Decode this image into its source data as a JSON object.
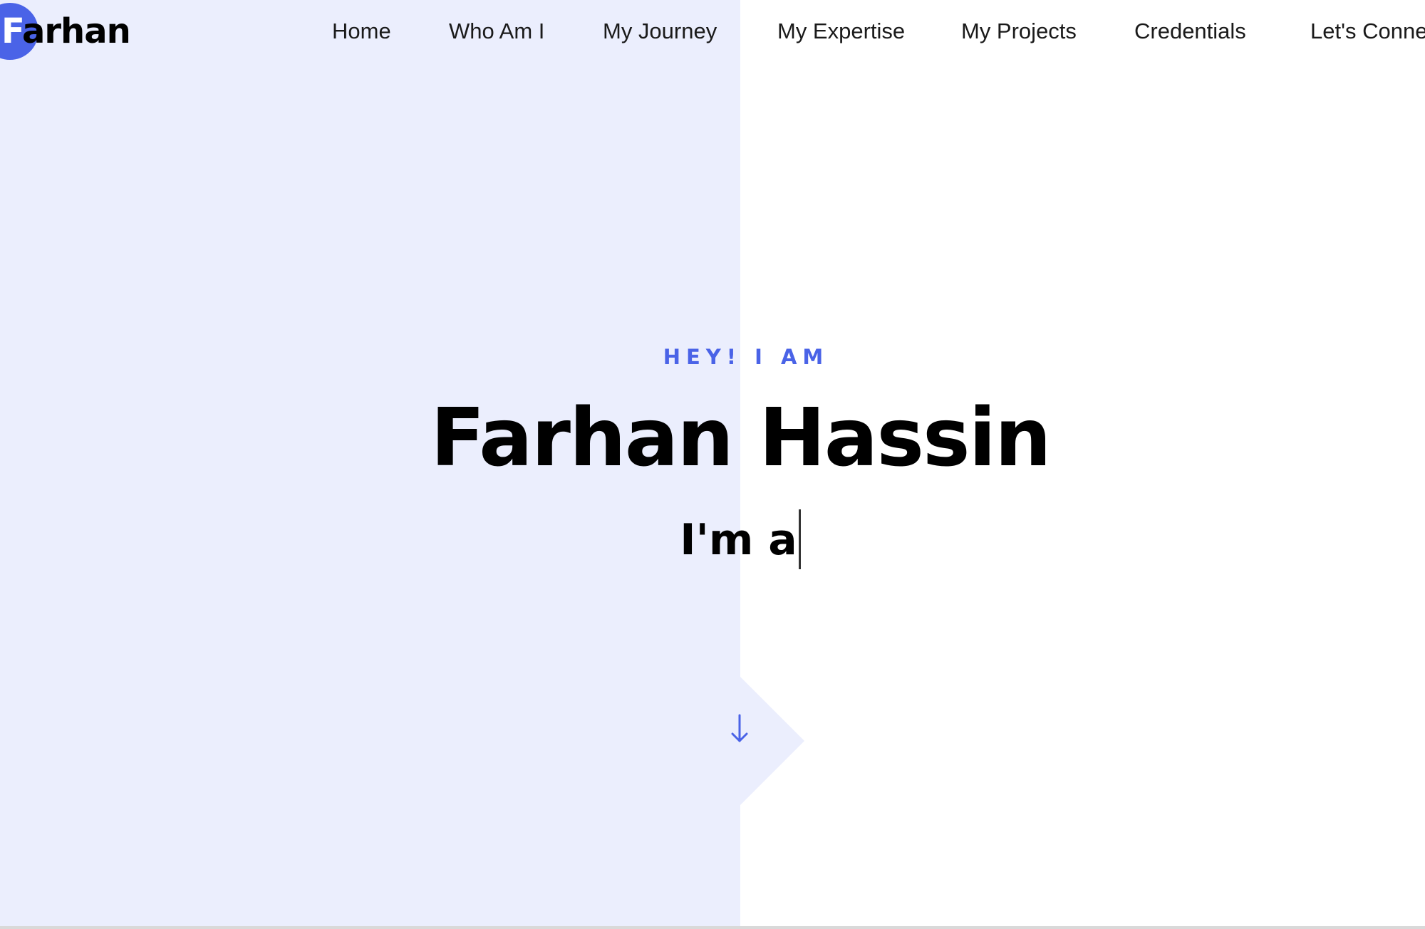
{
  "brand": {
    "logo_first": "F",
    "logo_rest": "arhan",
    "accent_color": "#4a63e7"
  },
  "nav": {
    "items": [
      {
        "label": "Home"
      },
      {
        "label": "Who Am I"
      },
      {
        "label": "My Journey"
      },
      {
        "label": "My Expertise"
      },
      {
        "label": "My Projects"
      },
      {
        "label": "Credentials"
      },
      {
        "label": "Let's Conne"
      }
    ]
  },
  "hero": {
    "eyebrow": "HEY! I AM",
    "name": "Farhan Hassin",
    "typed_text": "I'm a"
  },
  "icons": {
    "scroll": "arrow-down-icon"
  }
}
